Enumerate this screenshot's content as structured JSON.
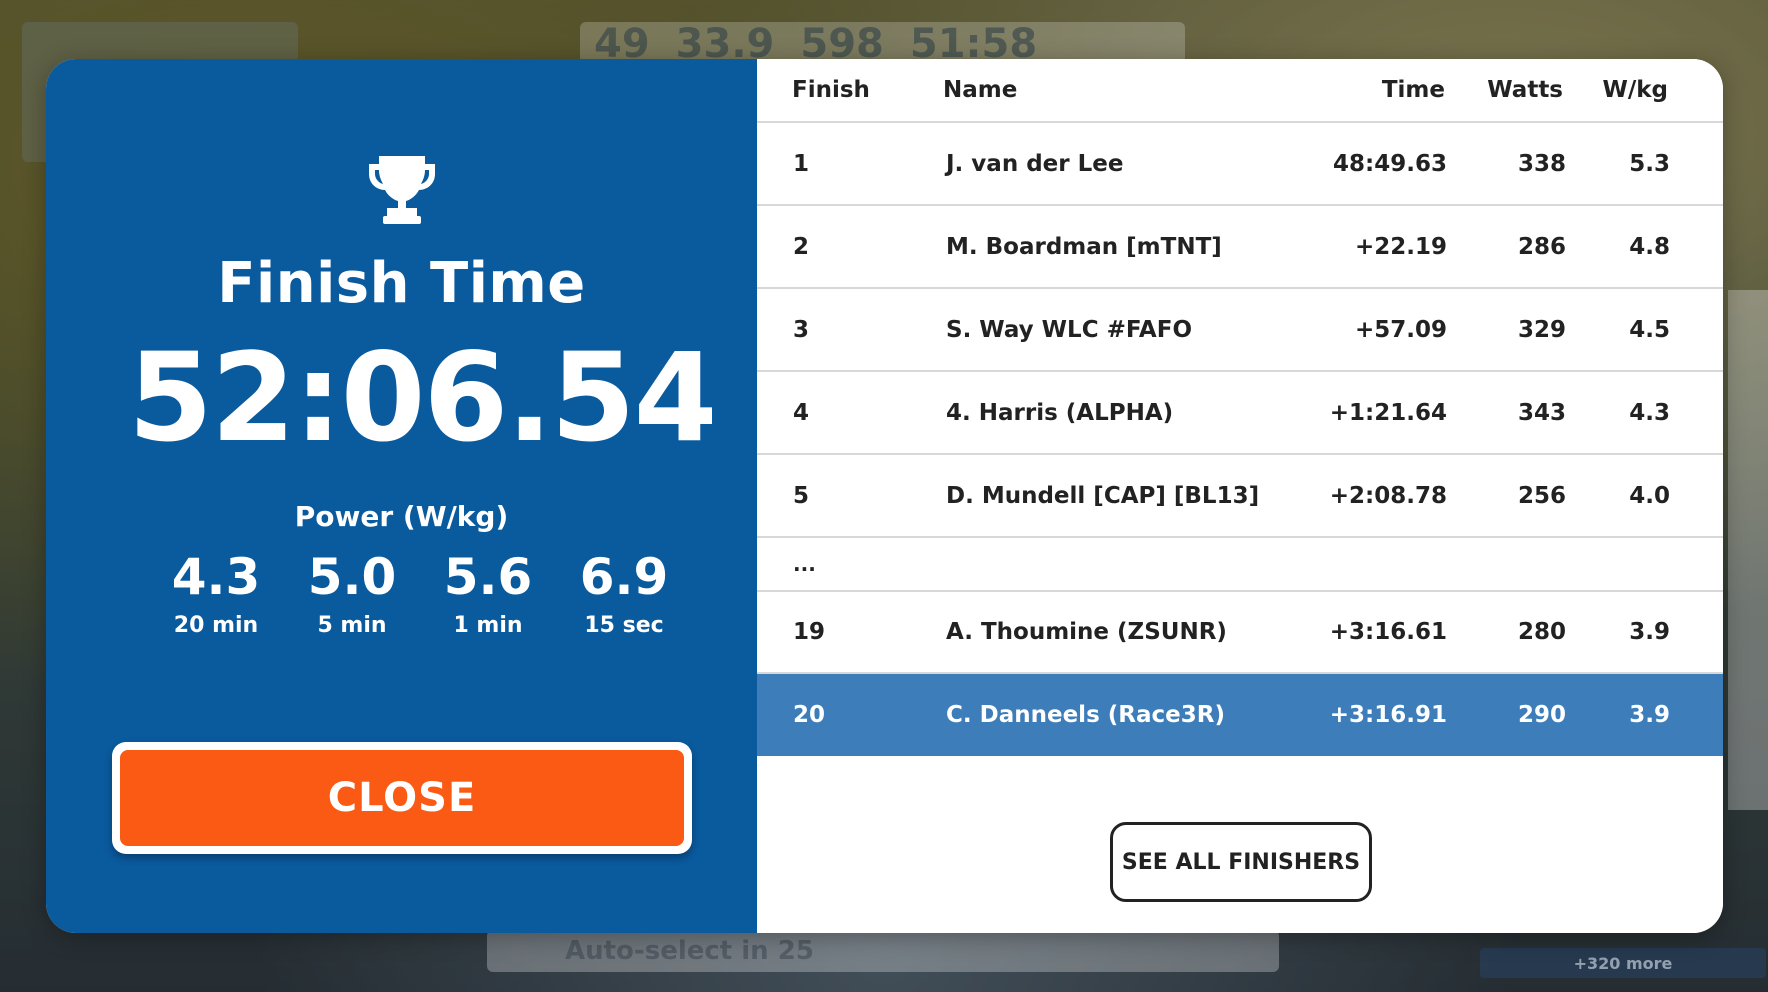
{
  "background_hud": {
    "speed": "49",
    "distance": "33.9",
    "elevation": "598",
    "elapsed": "51:58",
    "auto_select": "Auto-select in 25",
    "more_riders": "+320 more"
  },
  "summary": {
    "title": "Finish Time",
    "finish_time": "52:06.54",
    "power_label": "Power (W/kg)",
    "power_stats": [
      {
        "value": "4.3",
        "label": "20 min"
      },
      {
        "value": "5.0",
        "label": "5 min"
      },
      {
        "value": "5.6",
        "label": "1 min"
      },
      {
        "value": "6.9",
        "label": "15 sec"
      }
    ],
    "close_label": "CLOSE"
  },
  "results": {
    "headers": {
      "finish": "Finish",
      "name": "Name",
      "time": "Time",
      "watts": "Watts",
      "wkg": "W/kg"
    },
    "rows": [
      {
        "pos": "1",
        "name": "J. van der Lee",
        "time": "48:49.63",
        "watts": "338",
        "wkg": "5.3"
      },
      {
        "pos": "2",
        "name": "M. Boardman [mTNT]",
        "time": "+22.19",
        "watts": "286",
        "wkg": "4.8"
      },
      {
        "pos": "3",
        "name": "S. Way WLC #FAFO",
        "time": "+57.09",
        "watts": "329",
        "wkg": "4.5"
      },
      {
        "pos": "4",
        "name": "4. Harris (ALPHA)",
        "time": "+1:21.64",
        "watts": "343",
        "wkg": "4.3"
      },
      {
        "pos": "5",
        "name": "D. Mundell [CAP] [BL13]",
        "time": "+2:08.78",
        "watts": "256",
        "wkg": "4.0"
      },
      {
        "pos": "...",
        "name": "",
        "time": "",
        "watts": "",
        "wkg": ""
      },
      {
        "pos": "19",
        "name": "A. Thoumine (ZSUNR)",
        "time": "+3:16.61",
        "watts": "280",
        "wkg": "3.9"
      },
      {
        "pos": "20",
        "name": "C. Danneels (Race3R)",
        "time": "+3:16.91",
        "watts": "290",
        "wkg": "3.9"
      }
    ],
    "see_all_label": "SEE ALL FINISHERS"
  },
  "colors": {
    "panel_blue": "#0a5a9e",
    "highlight_row": "#3c7dba",
    "close_orange": "#fa5a14"
  }
}
